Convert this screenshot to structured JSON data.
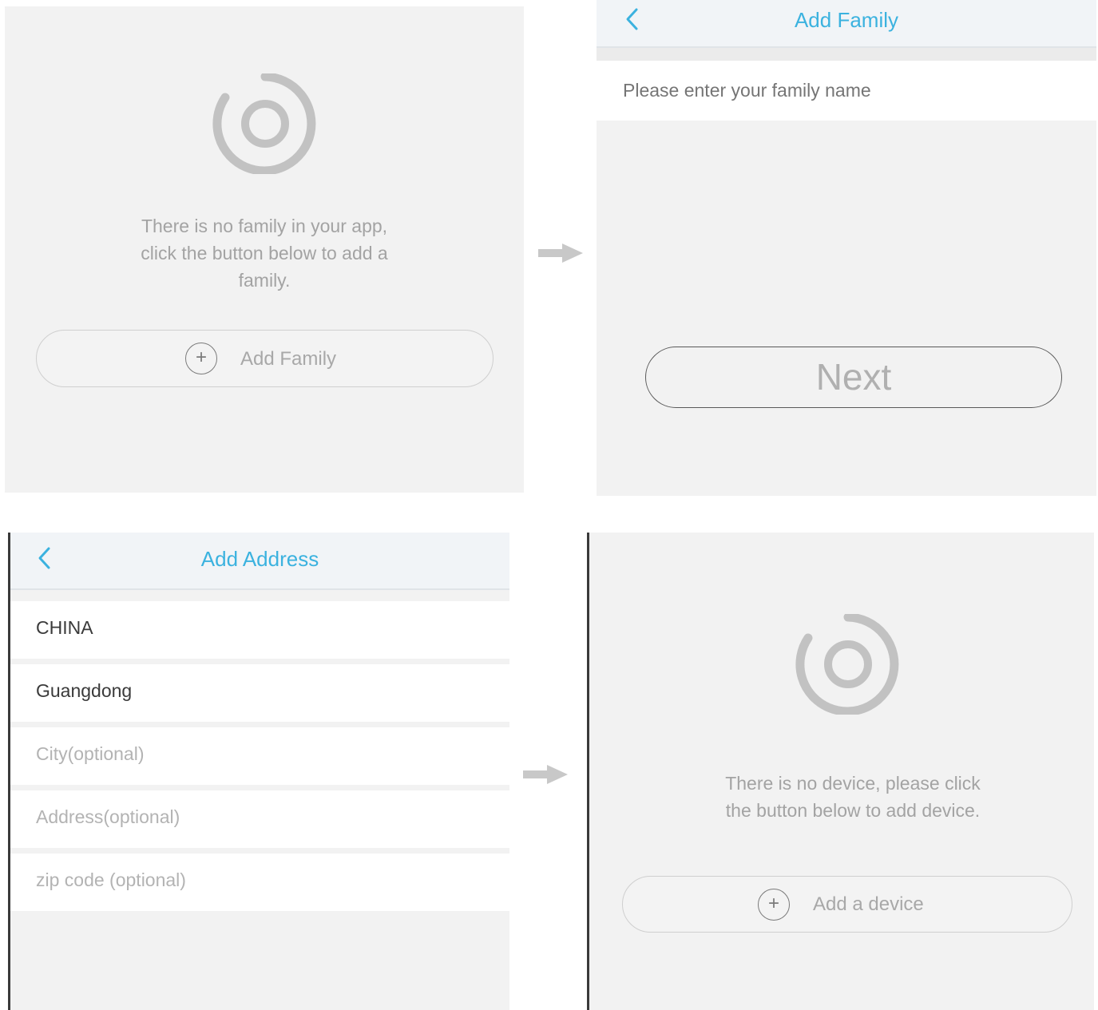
{
  "screen1": {
    "logo_icon": "ring-logo-icon",
    "message_lines": [
      "There is no family in your app,",
      "click the button below to add a",
      "family."
    ],
    "button_label": "Add Family",
    "button_icon": "plus-circle-icon"
  },
  "screen2": {
    "title": "Add Family",
    "back_icon": "chevron-left-icon",
    "family_name_placeholder": "Please enter your family name",
    "next_label": "Next"
  },
  "screen3": {
    "title": "Add Address",
    "back_icon": "chevron-left-icon",
    "fields": [
      {
        "text": "CHINA",
        "filled": true
      },
      {
        "text": "Guangdong",
        "filled": true
      },
      {
        "text": "City(optional)",
        "filled": false
      },
      {
        "text": "Address(optional)",
        "filled": false
      },
      {
        "text": "zip code (optional)",
        "filled": false
      }
    ]
  },
  "screen4": {
    "logo_icon": "ring-logo-icon",
    "message_lines": [
      "There is no device, please click",
      "the button below to add device."
    ],
    "button_label": "Add a device",
    "button_icon": "plus-circle-icon"
  },
  "flow_arrow_icon": "arrow-right-icon",
  "colors": {
    "accent": "#3bb2df",
    "screen_bg": "#f2f2f2",
    "muted_text": "#a3a3a3",
    "logo_gray": "#c2c2c2"
  }
}
